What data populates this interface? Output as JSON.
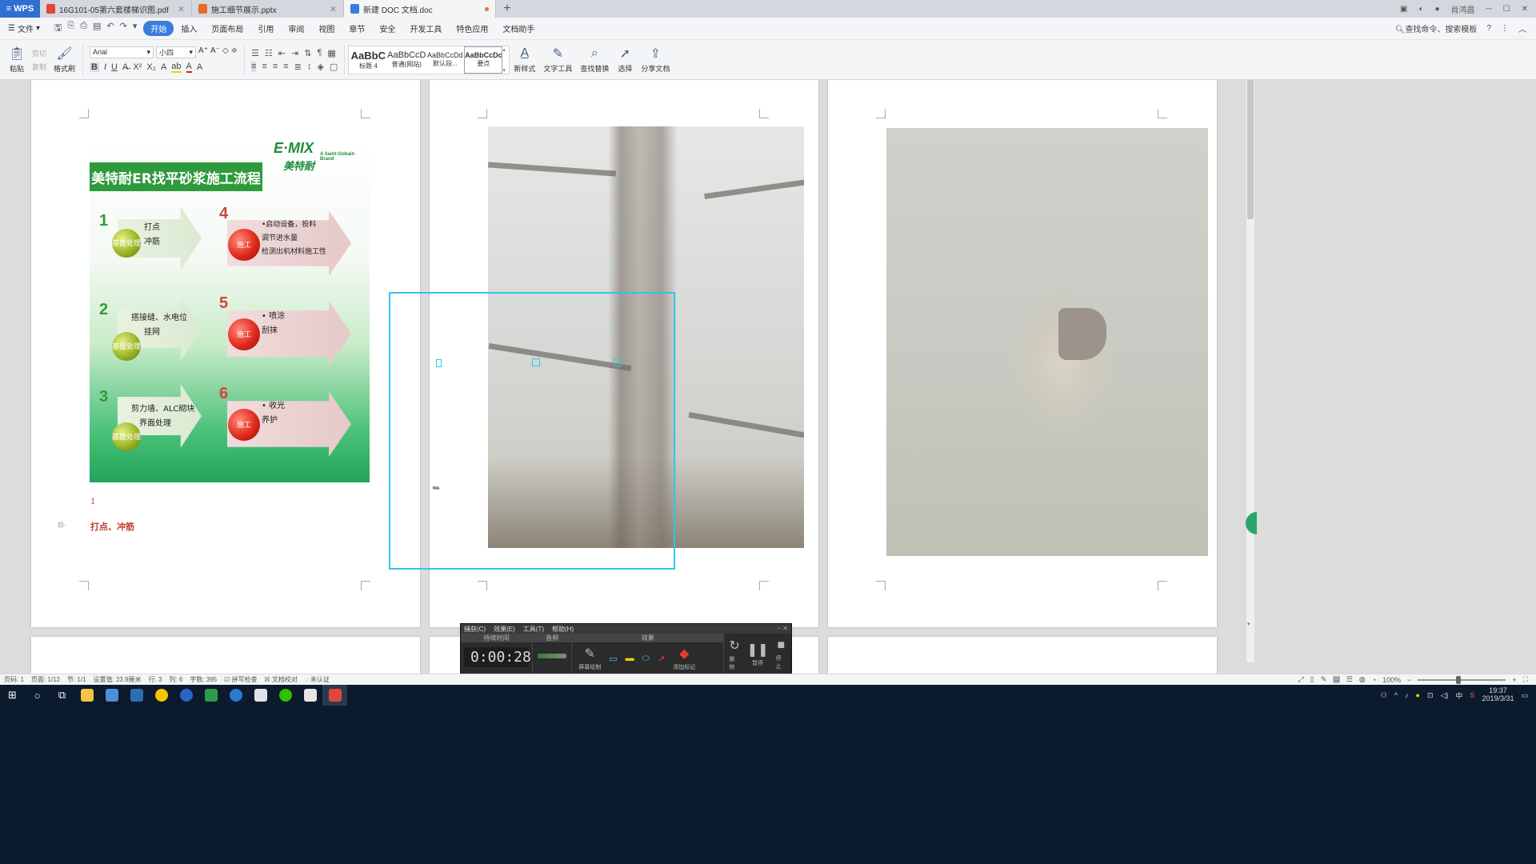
{
  "titlebar": {
    "app_name": "WPS",
    "tabs": [
      {
        "label": "16G101-05第六套楼梯识图.pdf",
        "color": "#e0463a"
      },
      {
        "label": "施工细节展示.pptx",
        "color": "#e8692c"
      },
      {
        "label": "新建 DOC 文档.doc",
        "color": "#3b7ddd"
      }
    ],
    "new_tab": "+",
    "user": "肖鸿昌"
  },
  "menubar": {
    "file": "文件",
    "items": [
      "开始",
      "插入",
      "页面布局",
      "引用",
      "审阅",
      "视图",
      "章节",
      "安全",
      "开发工具",
      "特色应用",
      "文档助手"
    ],
    "active_index": 0,
    "search": "查找命令、搜索模板"
  },
  "ribbon": {
    "paste": "粘贴",
    "cut": "剪切",
    "copy": "复制",
    "format_painter": "格式刷",
    "font_name": "Arial",
    "font_size": "小四",
    "styles": [
      {
        "sample": "AaBbC",
        "name": "标题 4"
      },
      {
        "sample": "AaBbCcD",
        "name": "普通(网站)"
      },
      {
        "sample": "AaBbCcDd",
        "name": "默认段..."
      },
      {
        "sample": "AaBbCcDc",
        "name": "要点"
      }
    ],
    "new_style": "新样式",
    "text_tools": "文字工具",
    "find_replace": "查找替换",
    "select": "选择",
    "share_doc": "分享文档"
  },
  "slide": {
    "logo": "E·MIX",
    "logo_cn": "美特耐",
    "brand": "A Saint-Gobain Brand",
    "title": "美特耐ER找平砂浆施工流程",
    "steps": [
      {
        "num": "1",
        "ball": "基面处理",
        "lines": [
          "打点",
          "冲筋"
        ]
      },
      {
        "num": "2",
        "ball": "基面处理",
        "lines": [
          "搭接缝、水电位",
          "挂网"
        ]
      },
      {
        "num": "3",
        "ball": "基面处理",
        "lines": [
          "剪力墙、ALC砌块",
          "界面处理"
        ]
      },
      {
        "num": "4",
        "ball": "施工",
        "lines": [
          "•启动设备，投料",
          "调节进水量",
          "检测出机材料施工性"
        ]
      },
      {
        "num": "5",
        "ball": "施工",
        "lines": [
          "• 喷涂",
          "刮抹"
        ]
      },
      {
        "num": "6",
        "ball": "施工",
        "lines": [
          "• 收光",
          "养护"
        ]
      }
    ]
  },
  "page1": {
    "number_line": "1",
    "caption": "打点、冲筋"
  },
  "recorder": {
    "menu": [
      "捕获(C)",
      "效果(E)",
      "工具(T)",
      "帮助(H)"
    ],
    "sections": [
      "持续时间",
      "音频",
      "效果"
    ],
    "time": "0:00:28",
    "tools": [
      "屏幕绘制",
      "添加标记",
      "删除",
      "暂停",
      "停止"
    ]
  },
  "statusbar": {
    "page_num": "页码: 1",
    "page": "页面: 1/12",
    "section": "节: 1/1",
    "setting": "设置值: 23.9厘米",
    "row": "行: 3",
    "col": "列: 6",
    "words": "字数: 395",
    "spell": "拼写检查",
    "proof": "文档校对",
    "auth": "未认证",
    "zoom": "100%"
  },
  "taskbar": {
    "time": "19:37",
    "date": "2019/3/31",
    "ime": "中"
  }
}
